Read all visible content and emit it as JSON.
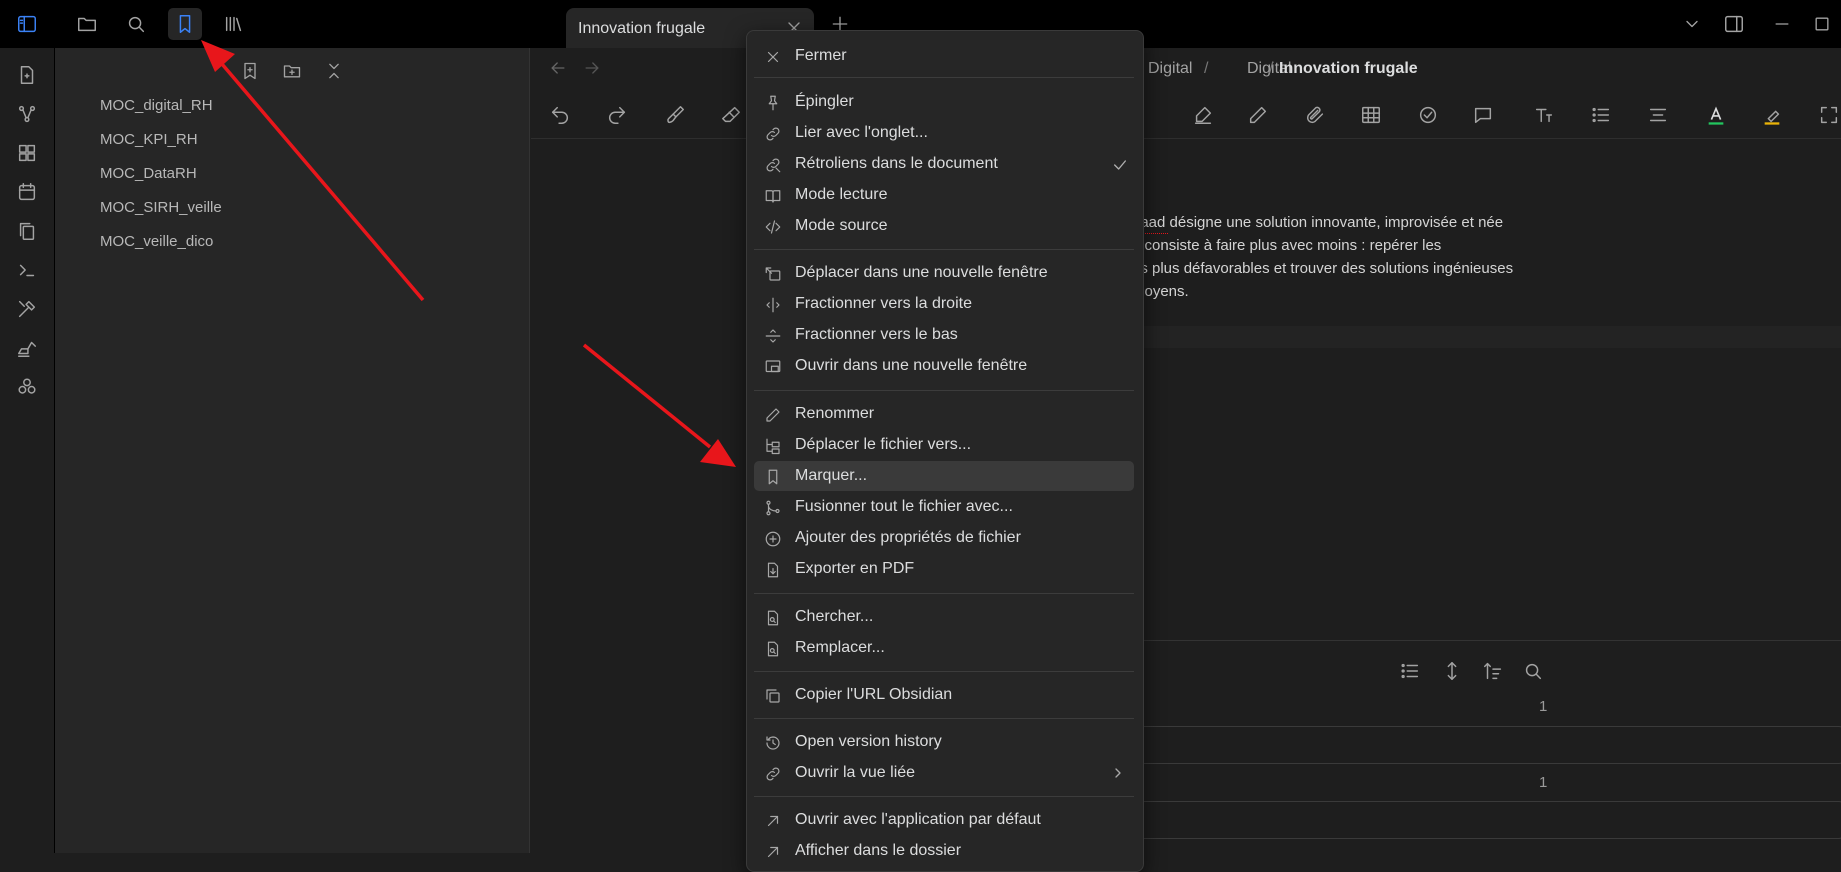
{
  "window": {
    "tab_title": "Innovation frugale"
  },
  "sidebar": {
    "bookmarks": [
      "MOC_digital_RH",
      "MOC_KPI_RH",
      "MOC_DataRH",
      "MOC_SIRH_veille",
      "MOC_veille_dico"
    ]
  },
  "breadcrumb": {
    "items": [
      "Digital",
      "Digital",
      "Innovation frugale"
    ],
    "separator": "/"
  },
  "content": {
    "lines": [
      "gaad désigne une solution innovante, improvisée et née",
      "e consiste à faire plus avec moins : repérer les",
      "es plus défavorables et trouver des solutions ingénieuses",
      "moyens."
    ],
    "counts": [
      "1",
      "1"
    ]
  },
  "menu": {
    "items": [
      {
        "label": "Fermer",
        "icon": "close-icon"
      },
      {
        "label": "Épingler",
        "icon": "pin-icon"
      },
      {
        "label": "Lier avec l'onglet...",
        "icon": "link-icon"
      },
      {
        "label": "Rétroliens dans le document",
        "icon": "backlinks-icon",
        "checked": true
      },
      {
        "label": "Mode lecture",
        "icon": "book-open-icon"
      },
      {
        "label": "Mode source",
        "icon": "code-icon"
      },
      {
        "label": "Déplacer dans une nouvelle fenêtre",
        "icon": "move-window-icon"
      },
      {
        "label": "Fractionner vers la droite",
        "icon": "split-right-icon"
      },
      {
        "label": "Fractionner vers le bas",
        "icon": "split-down-icon"
      },
      {
        "label": "Ouvrir dans une nouvelle fenêtre",
        "icon": "open-window-icon"
      },
      {
        "label": "Renommer",
        "icon": "pencil-icon"
      },
      {
        "label": "Déplacer le fichier vers...",
        "icon": "folder-tree-icon"
      },
      {
        "label": "Marquer...",
        "icon": "bookmark-icon",
        "highlighted": true
      },
      {
        "label": "Fusionner tout le fichier avec...",
        "icon": "git-merge-icon"
      },
      {
        "label": "Ajouter des propriétés de fichier",
        "icon": "plus-circle-icon"
      },
      {
        "label": "Exporter en PDF",
        "icon": "file-export-icon"
      },
      {
        "label": "Chercher...",
        "icon": "file-search-icon"
      },
      {
        "label": "Remplacer...",
        "icon": "file-replace-icon"
      },
      {
        "label": "Copier l'URL Obsidian",
        "icon": "copy-icon"
      },
      {
        "label": "Open version history",
        "icon": "history-icon"
      },
      {
        "label": "Ouvrir la vue liée",
        "icon": "link-icon",
        "submenu": true
      },
      {
        "label": "Ouvrir avec l'application par défaut",
        "icon": "arrow-up-right-icon"
      },
      {
        "label": "Afficher dans le dossier",
        "icon": "arrow-up-right-icon"
      }
    ]
  },
  "colors": {
    "accent": "#3b82f6",
    "annotation_arrow": "#e8161b",
    "menu_bg": "#262626",
    "menu_highlight": "#3a3a3a"
  }
}
